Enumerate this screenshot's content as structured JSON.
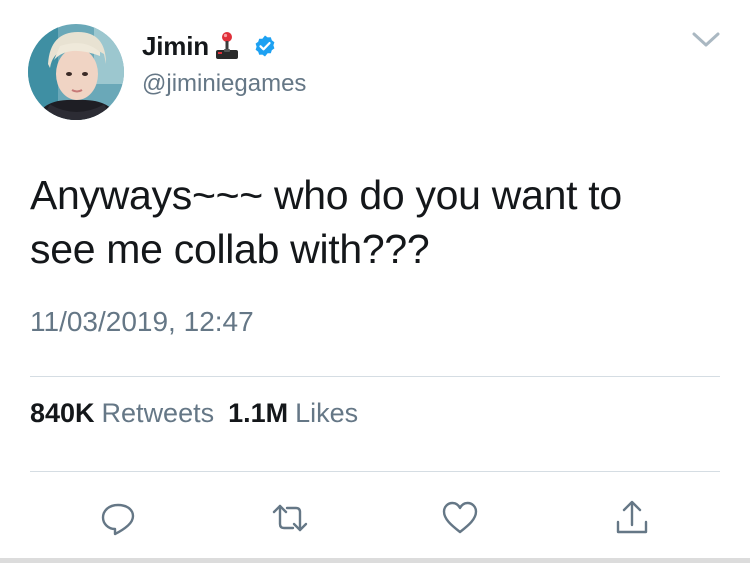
{
  "tweet": {
    "author": {
      "display_name": "Jimin",
      "handle": "@jiminiegames",
      "avatar_icon": "profile-photo",
      "name_emoji_icon": "joystick-icon",
      "verified": true,
      "verified_color": "#1da1f2"
    },
    "text": "Anyways~~~ who do you want to\nsee me collab with???",
    "timestamp": "11/03/2019, 12:47",
    "stats": {
      "retweets_count": "840K",
      "retweets_label": "Retweets",
      "likes_count": "1.1M",
      "likes_label": "Likes"
    },
    "actions": [
      "reply-icon",
      "retweet-icon",
      "like-icon",
      "share-icon"
    ]
  },
  "colors": {
    "text_primary": "#14171a",
    "text_secondary": "#657786",
    "divider": "#d5dde3",
    "icon": "#657786"
  }
}
